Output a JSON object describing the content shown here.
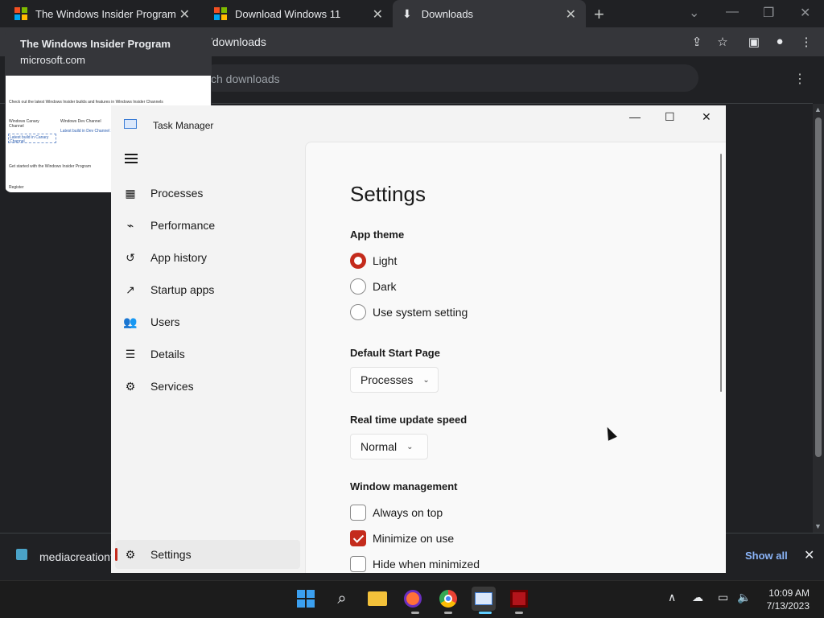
{
  "browser": {
    "tabs": [
      {
        "title": "The Windows Insider Program"
      },
      {
        "title": "Download Windows 11"
      },
      {
        "title": "Downloads"
      }
    ],
    "url": "/downloads",
    "search_placeholder": "ch downloads",
    "hover_card": {
      "title": "The Windows Insider Program",
      "domain": "microsoft.com",
      "thumb_lines": [
        "Check out the latest Windows Insider builds and features in Windows Insider Channels",
        "Windows Canary",
        "Channel",
        "Windows Dev Channel",
        "Latest build in Canary",
        "Channel",
        "Latest build in Dev Channel >",
        "Get started with the Windows Insider Program",
        "Register"
      ]
    },
    "download_bar": {
      "filename": "mediacreationto",
      "show_all": "Show all"
    }
  },
  "task_manager": {
    "title": "Task Manager",
    "nav": [
      {
        "label": "Processes",
        "icon": "processes-icon"
      },
      {
        "label": "Performance",
        "icon": "performance-icon"
      },
      {
        "label": "App history",
        "icon": "app-history-icon"
      },
      {
        "label": "Startup apps",
        "icon": "startup-icon"
      },
      {
        "label": "Users",
        "icon": "users-icon"
      },
      {
        "label": "Details",
        "icon": "details-icon"
      },
      {
        "label": "Services",
        "icon": "services-icon"
      }
    ],
    "settings_nav": {
      "label": "Settings",
      "icon": "gear-icon"
    },
    "settings": {
      "heading": "Settings",
      "app_theme": {
        "label": "App theme",
        "options": [
          "Light",
          "Dark",
          "Use system setting"
        ],
        "selected": "Light"
      },
      "default_start_page": {
        "label": "Default Start Page",
        "value": "Processes"
      },
      "update_speed": {
        "label": "Real time update speed",
        "value": "Normal"
      },
      "window_management": {
        "label": "Window management",
        "options": [
          {
            "label": "Always on top",
            "checked": false
          },
          {
            "label": "Minimize on use",
            "checked": true
          },
          {
            "label": "Hide when minimized",
            "checked": false
          }
        ]
      }
    }
  },
  "taskbar": {
    "time": "10:09 AM",
    "date": "7/13/2023"
  },
  "colors": {
    "accent": "#c42b1c",
    "chrome_dark": "#202124",
    "link": "#8ab4f8"
  }
}
